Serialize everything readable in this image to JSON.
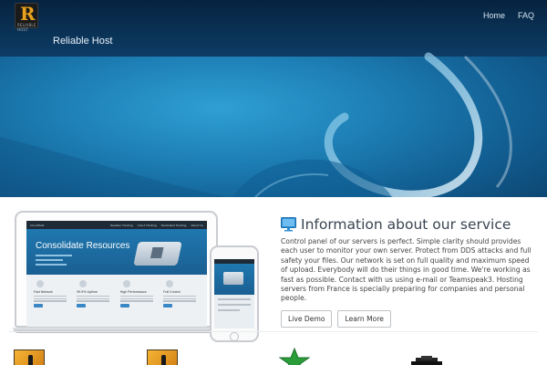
{
  "header": {
    "site_title": "Reliable Host",
    "logo": {
      "glyph": "R",
      "subtitle": "RELIABLE HOST",
      "icon": "r-logo"
    },
    "nav": [
      {
        "label": "Home"
      },
      {
        "label": "FAQ"
      }
    ]
  },
  "info": {
    "title": "Information about our service",
    "icon": "monitor-icon",
    "text": "Control panel of our servers is perfect. Simple clarity should provides each user to monitor your own server. Protect from DDS attacks and full safety your files. Our network is set on full quality and maximum speed of upload. Everybody will do their things in good time. We're working as fast as possible. Contact with us using e-mail or Teamspeak3. Hosting servers from France is specially preparing for companies and personal people.",
    "buttons": [
      {
        "label": "Live Demo"
      },
      {
        "label": "Learn More"
      }
    ]
  },
  "mockup": {
    "brand": "CloudHost",
    "nav": [
      "Reseller Hosting",
      "Cloud Hosting",
      "Dedicated Hosting",
      "About Us"
    ],
    "banner_title": "Consolidate Resources",
    "features": [
      {
        "title": "Fast Network",
        "icon": "rocket-icon"
      },
      {
        "title": "99.9% Uptime",
        "icon": "cloud-icon"
      },
      {
        "title": "High Performance",
        "icon": "plane-icon"
      },
      {
        "title": "Full Control",
        "icon": "gear-icon"
      }
    ]
  },
  "games": [
    {
      "icon": "counter-strike-icon"
    },
    {
      "icon": "counter-strike-icon"
    },
    {
      "icon": "green-star-icon"
    },
    {
      "icon": "tank-icon"
    }
  ],
  "colors": {
    "hero_dark": "#0b3f68",
    "hero_light": "#2f9fd3",
    "accent_blue": "#3a87c6",
    "text_dark": "#3a4452"
  }
}
